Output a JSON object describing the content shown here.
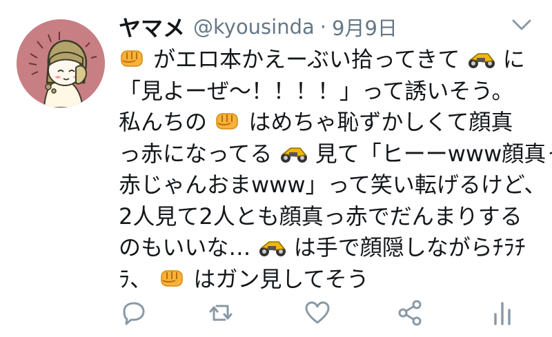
{
  "tweet": {
    "display_name": "ヤマメ",
    "handle": "@kyousinda",
    "separator": "·",
    "date": "9月9日",
    "lines": [
      [
        "[punch]",
        "がエロ本かえーぶい拾ってきて",
        "[bike]",
        "に"
      ],
      [
        "「見よーぜ〜！！！！」って誘いそう。"
      ],
      [
        "私んちの",
        "[punch]",
        "はめちゃ恥ずかしくて顔真"
      ],
      [
        "っ赤になってる",
        "[bike]",
        "見て「ヒーーwww顔真っ"
      ],
      [
        "赤じゃんおまwww」って笑い転げるけど、"
      ],
      [
        "2人見て2人とも顔真っ赤でだんまりする"
      ],
      [
        "のもいいな…",
        "[bike]",
        "は手で顔隠しながらﾁﾗﾁ"
      ],
      [
        "ﾗ、",
        "[punch]",
        "はガン見してそう"
      ]
    ]
  },
  "icons": {
    "menu": "chevron-down-icon",
    "reply": "reply-icon",
    "retweet": "retweet-icon",
    "like": "heart-icon",
    "share": "share-icon",
    "analytics": "analytics-icon",
    "punch_emoji": "oncoming-fist-icon",
    "bike_emoji": "motorcycle-icon"
  },
  "colors": {
    "text": "#14171a",
    "secondary": "#657786",
    "avatar_bg": "#c77f84",
    "emoji_fist": "#f7b23b",
    "emoji_bike": "#f2b705"
  }
}
